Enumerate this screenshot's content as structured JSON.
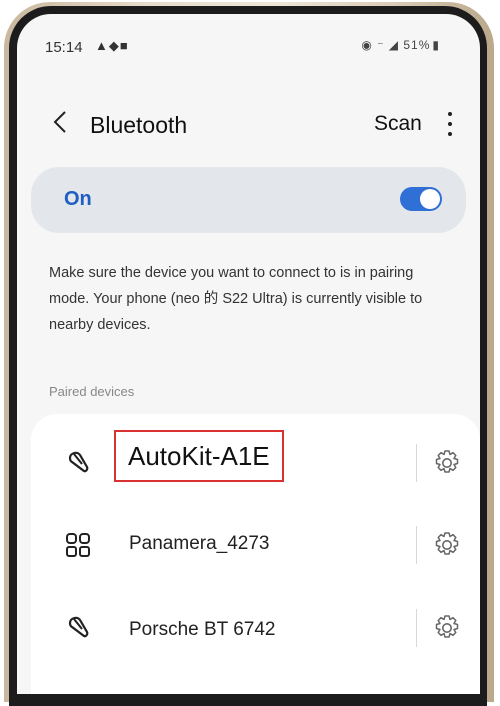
{
  "status_bar": {
    "time": "15:14",
    "left_icons": "▲◆■",
    "right_icons": "◉ ⁻ ◢",
    "battery": "51%"
  },
  "app_bar": {
    "title": "Bluetooth",
    "scan_label": "Scan"
  },
  "bluetooth_toggle": {
    "label": "On",
    "state": true,
    "accent_color": "#2f6fd6"
  },
  "info_text": "Make sure the device you want to connect to is in pairing mode. Your phone (neo 的 S22 Ultra) is currently visible to nearby devices.",
  "paired_devices": {
    "header": "Paired devices",
    "devices": [
      {
        "name": "AutoKit-A1E",
        "icon": "headset-icon",
        "highlighted": true,
        "highlight_color": "#d93030"
      },
      {
        "name": "Panamera_4273",
        "icon": "car-grid-icon"
      },
      {
        "name": "Porsche BT 6742",
        "icon": "headset-icon"
      }
    ]
  }
}
